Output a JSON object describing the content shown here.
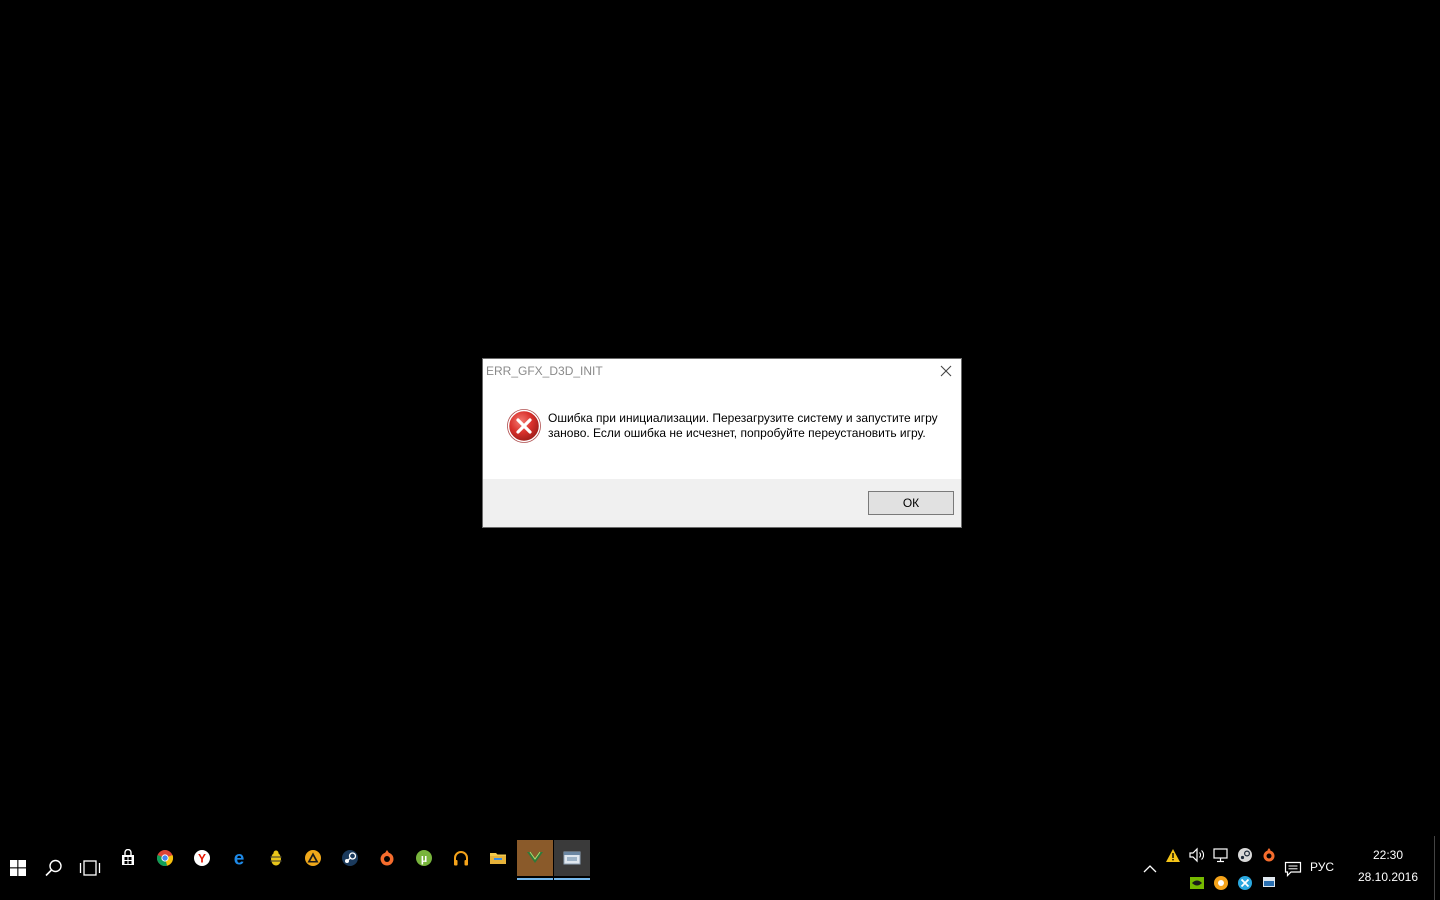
{
  "dialog": {
    "title": "ERR_GFX_D3D_INIT",
    "message": "Ошибка при инициализации. Перезагрузите систему и запустите игру заново. Если ошибка не исчезнет, попробуйте переустановить игру.",
    "ok_label": "ОК",
    "icon": "error-icon"
  },
  "taskbar": {
    "start_icon": "windows-start-icon",
    "search_icon": "search-icon",
    "task_view_icon": "task-view-icon",
    "pinned": [
      {
        "name": "store-icon"
      },
      {
        "name": "chrome-icon"
      },
      {
        "name": "yandex-browser-icon"
      },
      {
        "name": "edge-icon"
      },
      {
        "name": "app-yellow-icon"
      },
      {
        "name": "app-triangle-icon"
      },
      {
        "name": "steam-icon"
      },
      {
        "name": "origin-icon"
      },
      {
        "name": "utorrent-icon"
      },
      {
        "name": "headphones-icon"
      },
      {
        "name": "file-explorer-icon"
      },
      {
        "name": "gta-game-icon"
      },
      {
        "name": "dialog-window-icon"
      }
    ]
  },
  "tray": {
    "language": "РУС",
    "time": "22:30",
    "date": "28.10.2016",
    "colors": {
      "active_app_bg": "#8a5a2a",
      "underline": "#76b9ed",
      "error_red": "#d9312c"
    }
  }
}
